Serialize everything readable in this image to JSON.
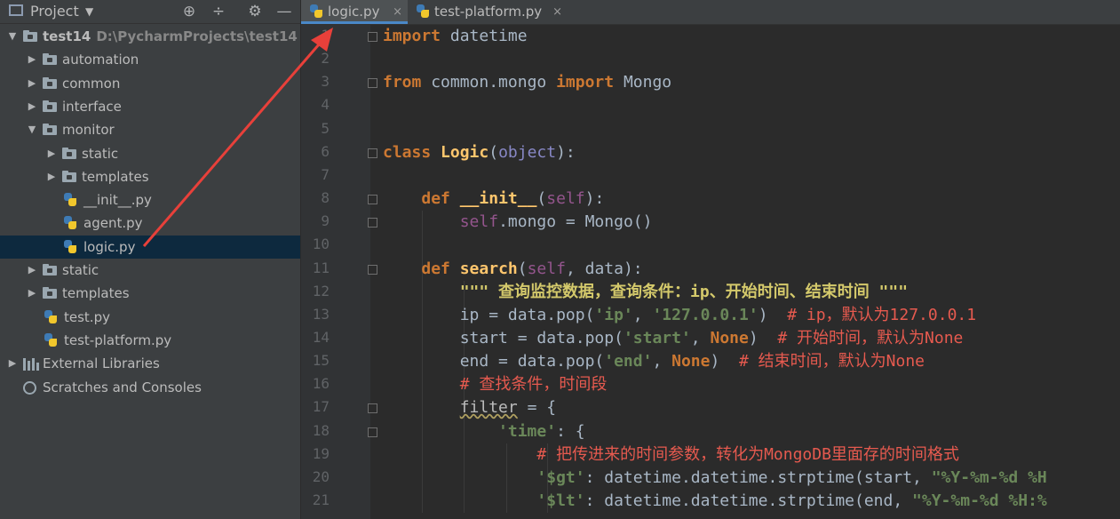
{
  "panel": {
    "title": "Project",
    "dropdown_icon": "▼",
    "tools": [
      "⊕",
      "÷",
      "⚙",
      "—"
    ],
    "tool_names": [
      "locate-icon",
      "collapse-icon",
      "gear-icon",
      "hide-icon"
    ]
  },
  "tree": [
    {
      "label": "test14",
      "path": "D:\\PycharmProjects\\test14",
      "kind": "folder",
      "depth": 0,
      "arrow": "▼",
      "bold": true
    },
    {
      "label": "automation",
      "kind": "folder",
      "depth": 1,
      "arrow": "▶"
    },
    {
      "label": "common",
      "kind": "folder",
      "depth": 1,
      "arrow": "▶"
    },
    {
      "label": "interface",
      "kind": "folder",
      "depth": 1,
      "arrow": "▶"
    },
    {
      "label": "monitor",
      "kind": "folder",
      "depth": 1,
      "arrow": "▼"
    },
    {
      "label": "static",
      "kind": "folder",
      "depth": 2,
      "arrow": "▶"
    },
    {
      "label": "templates",
      "kind": "folder",
      "depth": 2,
      "arrow": "▶"
    },
    {
      "label": "__init__.py",
      "kind": "py",
      "depth": 2
    },
    {
      "label": "agent.py",
      "kind": "py",
      "depth": 2
    },
    {
      "label": "logic.py",
      "kind": "py",
      "depth": 2,
      "selected": true
    },
    {
      "label": "static",
      "kind": "folder",
      "depth": 1,
      "arrow": "▶"
    },
    {
      "label": "templates",
      "kind": "folder",
      "depth": 1,
      "arrow": "▶"
    },
    {
      "label": "test.py",
      "kind": "py",
      "depth": 1
    },
    {
      "label": "test-platform.py",
      "kind": "py",
      "depth": 1
    },
    {
      "label": "External Libraries",
      "kind": "lib",
      "depth": 0,
      "arrow": "▶"
    },
    {
      "label": "Scratches and Consoles",
      "kind": "scratch",
      "depth": 0
    }
  ],
  "tabs": [
    {
      "label": "logic.py",
      "active": true
    },
    {
      "label": "test-platform.py",
      "active": false
    }
  ],
  "close_glyph": "×",
  "code_lines": [
    [
      [
        "kw",
        "import"
      ],
      [
        "id",
        " datetime"
      ]
    ],
    [],
    [
      [
        "kw",
        "from"
      ],
      [
        "id",
        " common.mongo "
      ],
      [
        "kw",
        "import"
      ],
      [
        "id",
        " Mongo"
      ]
    ],
    [],
    [],
    [
      [
        "kw",
        "class "
      ],
      [
        "fn",
        "Logic"
      ],
      [
        "id",
        "("
      ],
      [
        "bi",
        "object"
      ],
      [
        "id",
        "):"
      ]
    ],
    [],
    [
      [
        "id",
        "    "
      ],
      [
        "kw",
        "def "
      ],
      [
        "fn",
        "__init__"
      ],
      [
        "id",
        "("
      ],
      [
        "self",
        "self"
      ],
      [
        "id",
        "):"
      ]
    ],
    [
      [
        "id",
        "        "
      ],
      [
        "self",
        "self"
      ],
      [
        "id",
        ".mongo = Mongo()"
      ]
    ],
    [],
    [
      [
        "id",
        "    "
      ],
      [
        "kw",
        "def "
      ],
      [
        "fn",
        "search"
      ],
      [
        "id",
        "("
      ],
      [
        "self",
        "self"
      ],
      [
        "id",
        ", data):"
      ]
    ],
    [
      [
        "id",
        "        "
      ],
      [
        "doc",
        "\"\"\" 查询监控数据，查询条件：ip、开始时间、结束时间 \"\"\""
      ]
    ],
    [
      [
        "id",
        "        ip = data.pop("
      ],
      [
        "str",
        "'ip'"
      ],
      [
        "id",
        ", "
      ],
      [
        "str",
        "'127.0.0.1'"
      ],
      [
        "id",
        ")  "
      ],
      [
        "cmt",
        "# ip，默认为127.0.0.1"
      ]
    ],
    [
      [
        "id",
        "        start = data.pop("
      ],
      [
        "str",
        "'start'"
      ],
      [
        "id",
        ", "
      ],
      [
        "kw",
        "None"
      ],
      [
        "id",
        ")  "
      ],
      [
        "cmt",
        "# 开始时间，默认为None"
      ]
    ],
    [
      [
        "id",
        "        end = data.pop("
      ],
      [
        "str",
        "'end'"
      ],
      [
        "id",
        ", "
      ],
      [
        "kw",
        "None"
      ],
      [
        "id",
        ")  "
      ],
      [
        "cmt",
        "# 结束时间，默认为None"
      ]
    ],
    [
      [
        "id",
        "        "
      ],
      [
        "cmt",
        "# 查找条件，时间段"
      ]
    ],
    [
      [
        "id",
        "        "
      ],
      [
        "squig",
        "filter"
      ],
      [
        "id",
        " = {"
      ]
    ],
    [
      [
        "id",
        "            "
      ],
      [
        "str",
        "'time'"
      ],
      [
        "id",
        ": {"
      ]
    ],
    [
      [
        "id",
        "                "
      ],
      [
        "cmt",
        "# 把传进来的时间参数，转化为MongoDB里面存的时间格式"
      ]
    ],
    [
      [
        "id",
        "                "
      ],
      [
        "str",
        "'$gt'"
      ],
      [
        "id",
        ": datetime.datetime.strptime(start, "
      ],
      [
        "str",
        "\"%Y-%m-%d %H"
      ]
    ],
    [
      [
        "id",
        "                "
      ],
      [
        "str",
        "'$lt'"
      ],
      [
        "id",
        ": datetime.datetime.strptime(end, "
      ],
      [
        "str",
        "\"%Y-%m-%d %H:%"
      ]
    ]
  ],
  "line_numbers": [
    "1",
    "2",
    "3",
    "4",
    "5",
    "6",
    "7",
    "8",
    "9",
    "10",
    "11",
    "12",
    "13",
    "14",
    "15",
    "16",
    "17",
    "18",
    "19",
    "20",
    "21"
  ],
  "colors": {
    "annotation_arrow": "#e8403a",
    "selection": "#0d293e",
    "tab_underline": "#4a88c7"
  }
}
